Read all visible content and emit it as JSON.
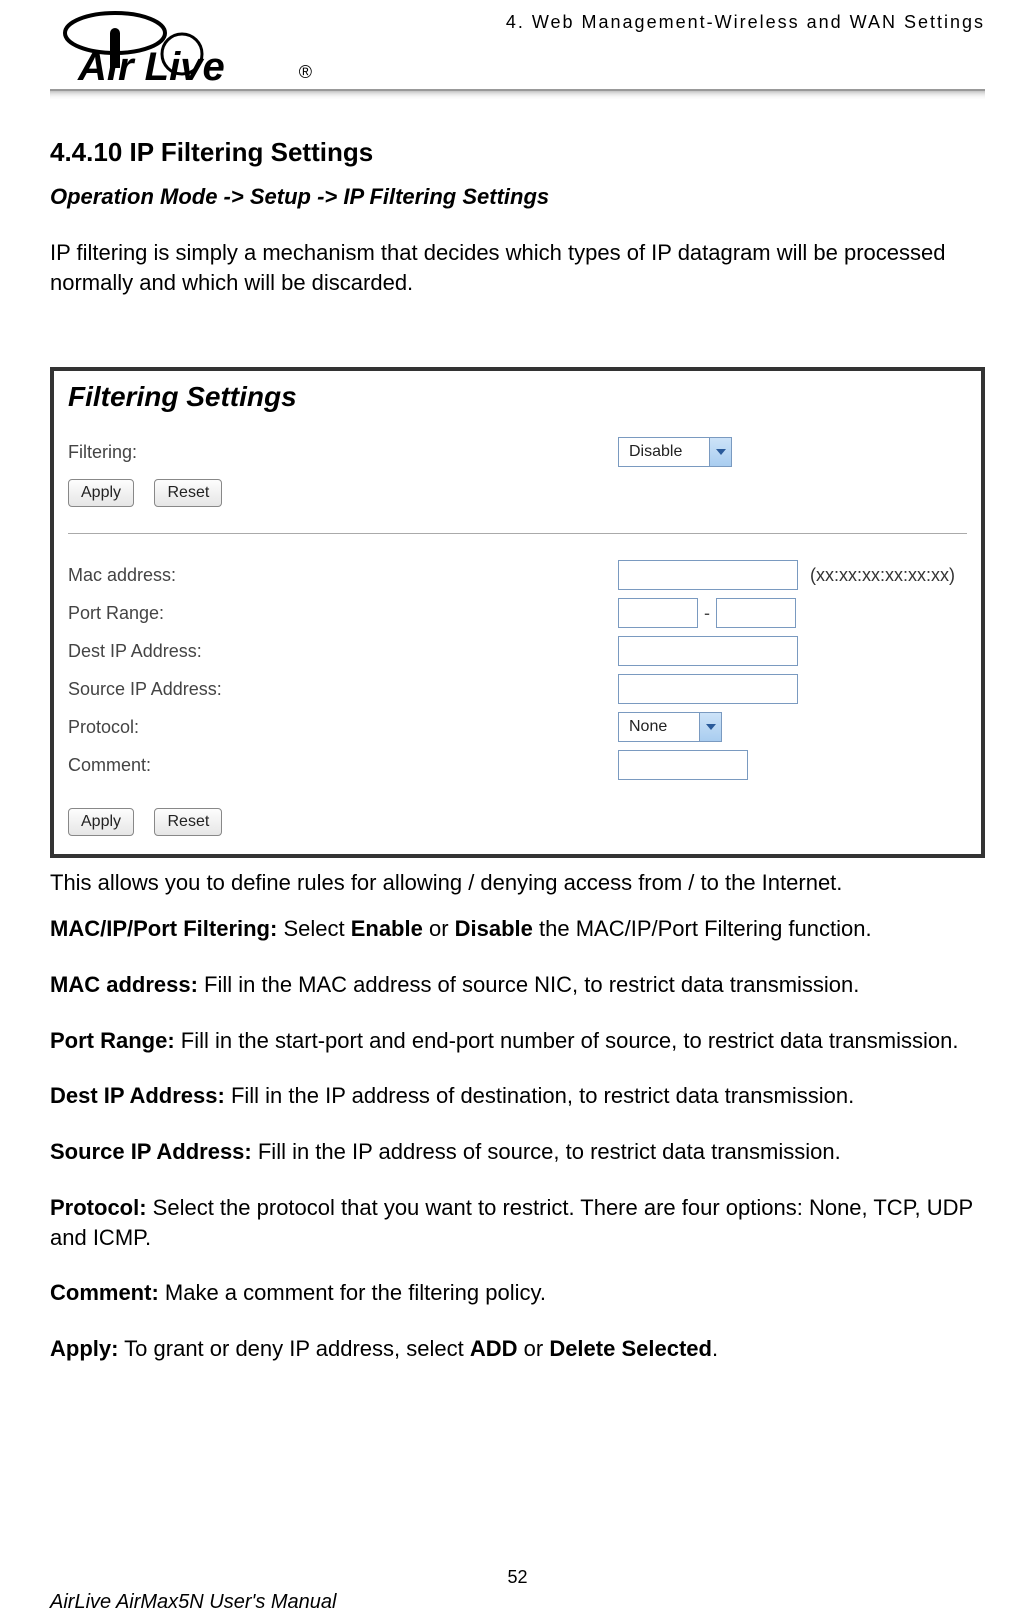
{
  "header": {
    "chapter": "4. Web Management-Wireless and WAN Settings",
    "logo_alt": "Air Live"
  },
  "section": {
    "number_title": "4.4.10 IP Filtering Settings",
    "breadcrumb": "Operation Mode -> Setup -> IP Filtering Settings",
    "intro": "IP filtering is simply a mechanism that decides which types of IP datagram will be processed normally and which will be discarded."
  },
  "screenshot": {
    "title": "Filtering Settings",
    "filtering_label": "Filtering:",
    "filtering_value": "Disable",
    "apply": "Apply",
    "reset": "Reset",
    "mac_label": "Mac address:",
    "mac_hint": "(xx:xx:xx:xx:xx:xx)",
    "port_label": "Port Range:",
    "port_sep": "-",
    "dest_label": "Dest IP Address:",
    "source_label": "Source IP Address:",
    "protocol_label": "Protocol:",
    "protocol_value": "None",
    "comment_label": "Comment:"
  },
  "after": "This allows you to define rules for allowing / denying access from / to the Internet.",
  "defs": {
    "d1_b": "MAC/IP/Port Filtering:",
    "d1_1": " Select ",
    "d1_b2": "Enable",
    "d1_2": " or ",
    "d1_b3": "Disable",
    "d1_3": " the MAC/IP/Port Filtering function.",
    "d2_b": "MAC address:",
    "d2": " Fill in the MAC address of source NIC, to restrict data transmission.",
    "d3_b": "Port Range:",
    "d3": " Fill in the start-port and end-port number of source, to restrict data transmission.",
    "d4_b": "Dest IP Address:",
    "d4": " Fill in the IP address of destination, to restrict data transmission.",
    "d5_b": "Source IP Address:",
    "d5": " Fill in the IP address of source, to restrict data transmission.",
    "d6_b": "Protocol:",
    "d6": " Select the protocol that you want to restrict. There are four options: None, TCP, UDP and ICMP.",
    "d7_b": "Comment:",
    "d7": " Make a comment for the filtering policy.",
    "d8_b": "Apply:",
    "d8_1": " To grant or deny IP address, select ",
    "d8_b2": "ADD",
    "d8_2": " or ",
    "d8_b3": "Delete Selected",
    "d8_3": "."
  },
  "page_number": "52",
  "footer": "AirLive AirMax5N User's Manual"
}
